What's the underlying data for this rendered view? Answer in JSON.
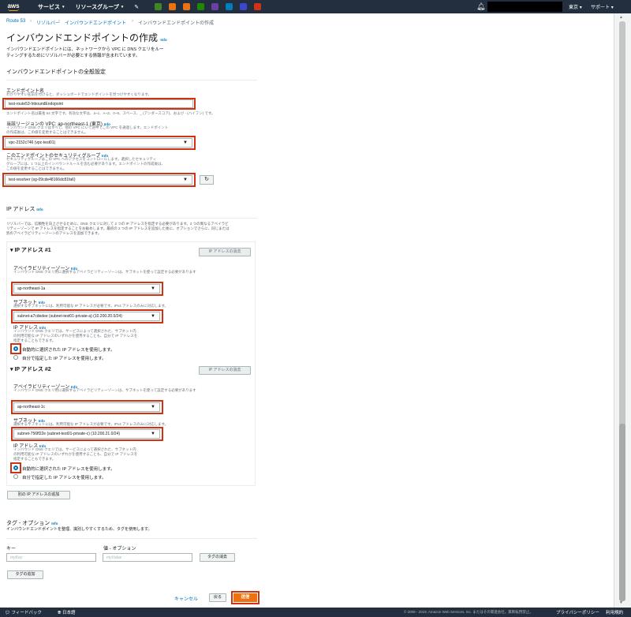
{
  "topnav": {
    "logo": "aws",
    "services": "サービス",
    "resource_groups": "リソースグループ",
    "region": "東京",
    "support": "サポート",
    "pin_colors": [
      "#3f8624",
      "#ec7211",
      "#ec7211",
      "#1e8900",
      "#6b40a5",
      "#007dbc",
      "#3b48cc",
      "#d13212"
    ]
  },
  "breadcrumb": [
    "Route 53",
    "リゾルバー",
    "インバウンドエンドポイント",
    "インバウンドエンドポイントの作成"
  ],
  "page": {
    "title": "インバウンドエンドポイントの作成",
    "info": "Info",
    "desc1": "インバウンドエンドポイントには、ネットワークから VPC に DNS クエリをルー",
    "desc2": "ティングするためにリゾルバーが必要とする情報が含まれています。"
  },
  "general": {
    "heading": "インバウンドエンドポイントの全般設定",
    "name_label": "エンドポイント名",
    "name_help": "わかりやすい名前を付けると、ダッシュボードでエンドポイントを見つけやすくなります。",
    "name_value": "test-route53-InboundEndopoint",
    "name_rule": "エンドポイント名は最長 64 文字です。有効な文字は、a~z、A~Z、0~9、スペース、_ (アンダースコア)、および - (ハイフン) です。",
    "vpc_label": "当該リージョンの VPC: ap-northeast-1 (東京)",
    "vpc_help1": "インバウンド DNS クエリはすべて、他の VPC にいて途中でこの VPC を通過します。エンドポイント",
    "vpc_help2": "の作成後は、この値を変更することはできません。",
    "vpc_value": "vpc-2152c746 (vpc-test01)",
    "sg_label": "このエンドポイントのセキュリティグループ",
    "sg_help1": "セキュリティグループはこの VPC へのアクセスをコントロールします。選択したセキュリティ",
    "sg_help2": "グループには、1 つ以上のインバウンドルールを含む必要があります。エンドポイントの作成後は、",
    "sg_help3": "この値を変更することはできません。",
    "sg_value": "test-resolver (sg-09cde48166dc81fa6)"
  },
  "ip": {
    "heading": "IP アドレス",
    "desc1": "リゾルバーでは、信頼性を向上させるために、DNS クエリに対して 2 つの IP アドレスを指定する必要があります。2 つの異なるアベイラビ",
    "desc2": "リティーゾーンで IP アドレスを指定することをお勧めします。最初の 2 つの IP アドレスを追加した後に、オプションでさらに、同じまたは",
    "desc3": "別のアベイラビリティーゾーンのアドレスを追加できます。",
    "remove_btn": "IP アドレスの消去",
    "add_btn": "別の IP アドレスの追加",
    "entries": [
      {
        "title": "IP アドレス #1",
        "az_label": "アベイラビリティーゾーン",
        "az_help": "インバウンド DNS クエリ用に選択するアベイラビリティーゾーンは、サブネットを使って設定する必要があります",
        "az_value": "ap-northeast-1a",
        "subnet_label": "サブネット",
        "subnet_help": "選択するサブネットには、利用可能な IP アドレスが必要です。IPv4 アドレスのみに対応します。",
        "subnet_value": "subnet-a7cdedee (subnet-test01-private-a) (10.200.20.0/24)",
        "ipaddr_label": "IP アドレス",
        "ipaddr_help1": "インバウンド DNS クエリでは、サービスによって選択された、サブネット内",
        "ipaddr_help2": "の利用可能な IP アドレスのいずれかを使用することも、自分で IP アドレスを",
        "ipaddr_help3": "指定することもできます。",
        "opt_auto": "自動的に選択された IP アドレスを使用します。",
        "opt_manual": "自分で指定した IP アドレスを使用します。"
      },
      {
        "title": "IP アドレス #2",
        "az_label": "アベイラビリティーゾーン",
        "az_help": "インバウンド DNS クエリ用に選択するアベイラビリティーゾーンは、サブネットを使って設定する必要があります",
        "az_value": "ap-northeast-1c",
        "subnet_label": "サブネット",
        "subnet_help": "選択するサブネットには、利用可能な IP アドレスが必要です。IPv4 アドレスのみに対応します。",
        "subnet_value": "subnet-756ff22e (subnet-test01-private-c) (10.200.21.0/24)",
        "ipaddr_label": "IP アドレス",
        "ipaddr_help1": "インバウンド DNS クエリでは、サービスによって選択された、サブネット内",
        "ipaddr_help2": "の利用可能な IP アドレスのいずれかを使用することも、自分で IP アドレスを",
        "ipaddr_help3": "指定することもできます。",
        "opt_auto": "自動的に選択された IP アドレスを使用します。",
        "opt_manual": "自分で指定した IP アドレスを使用します。"
      }
    ]
  },
  "tags": {
    "heading": "タグ - オプション",
    "desc": "インバウンドエンドポイントを整理、識別しやすくするため、タグを使用します。",
    "key_label": "キー",
    "value_label": "値 - オプション",
    "key_placeholder": "myKey",
    "value_placeholder": "myValue",
    "remove_btn": "タグの消去",
    "add_btn": "タグの追加"
  },
  "actions": {
    "cancel": "キャンセル",
    "back": "戻る",
    "submit": "送信"
  },
  "footer": {
    "feedback": "フィードバック",
    "language": "日本語",
    "copyright": "© 2008 - 2019, Amazon Web Services, Inc. またはその関連会社。無断転用禁止。",
    "privacy": "プライバシーポリシー",
    "terms": "利用規約"
  }
}
